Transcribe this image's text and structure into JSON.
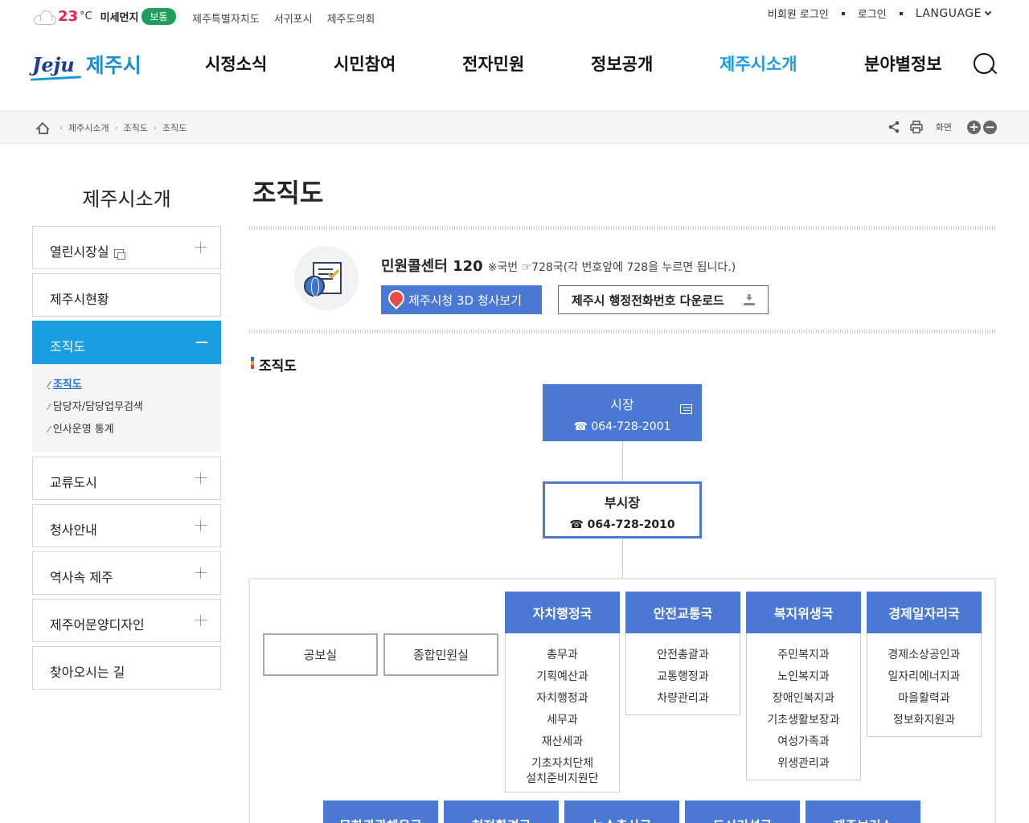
{
  "topbar": {
    "temperature": "23",
    "temp_unit": "°C",
    "dust_label": "미세먼지",
    "dust_status": "보통",
    "links": [
      "제주특별자치도",
      "서귀포시",
      "제주도의회"
    ],
    "guest_login": "비회원 로그인",
    "login": "로그인",
    "language": "LANGUAGE"
  },
  "header": {
    "logo_en": "Jeju",
    "logo_ko": "제주시",
    "nav": [
      "시정소식",
      "시민참여",
      "전자민원",
      "정보공개",
      "제주시소개",
      "분야별정보"
    ],
    "active_nav": "제주시소개"
  },
  "breadcrumb": {
    "items": [
      "제주시소개",
      "조직도",
      "조직도"
    ],
    "screen_label": "화면"
  },
  "sidebar": {
    "title": "제주시소개",
    "items": [
      {
        "label": "열린시장실"
      },
      {
        "label": "제주시현황"
      },
      {
        "label": "조직도"
      },
      {
        "label": "교류도시"
      },
      {
        "label": "청사안내"
      },
      {
        "label": "역사속 제주"
      },
      {
        "label": "제주어문양디자인"
      },
      {
        "label": "찾아오시는 길"
      }
    ],
    "sub_items": [
      "조직도",
      "담당자/담당업무검색",
      "인사운영 통계"
    ]
  },
  "main": {
    "title": "조직도",
    "callcenter_title": "민원콜센터 120",
    "callcenter_note": "※국번 ☞728국(각 번호앞에 728을 누르면 됩니다.)",
    "btn_3d": "제주시청 3D 청사보기",
    "btn_download": "제주시 행정전화번호 다운로드",
    "section_title": "조직도"
  },
  "org": {
    "mayor": {
      "title": "시장",
      "phone": "☎ 064-728-2001"
    },
    "vice": {
      "title": "부시장",
      "phone": "☎ 064-728-2010"
    },
    "offices": [
      "공보실",
      "종합민원실"
    ],
    "departments": [
      {
        "name": "자치행정국",
        "teams": [
          "총무과",
          "기획예산과",
          "자치행정과",
          "세무과",
          "재산세과",
          "기초자치단체\n설치준비지원단"
        ]
      },
      {
        "name": "안전교통국",
        "teams": [
          "안전총괄과",
          "교통행정과",
          "차량관리과"
        ]
      },
      {
        "name": "복지위생국",
        "teams": [
          "주민복지과",
          "노인복지과",
          "장애인복지과",
          "기초생활보장과",
          "여성가족과",
          "위생관리과"
        ]
      },
      {
        "name": "경제일자리국",
        "teams": [
          "경제소상공인과",
          "일자리에너지과",
          "마을활력과",
          "정보화지원과"
        ]
      }
    ],
    "departments_row2": [
      "문화관광체육국",
      "청정환경국",
      "농수축산국",
      "도시건설국",
      "제주보건소"
    ]
  },
  "colors": {
    "accent": "#1a9ce0",
    "org_blue": "#4a78d3",
    "temp_red": "#e6224f",
    "dust_green": "#1e9d5b"
  }
}
